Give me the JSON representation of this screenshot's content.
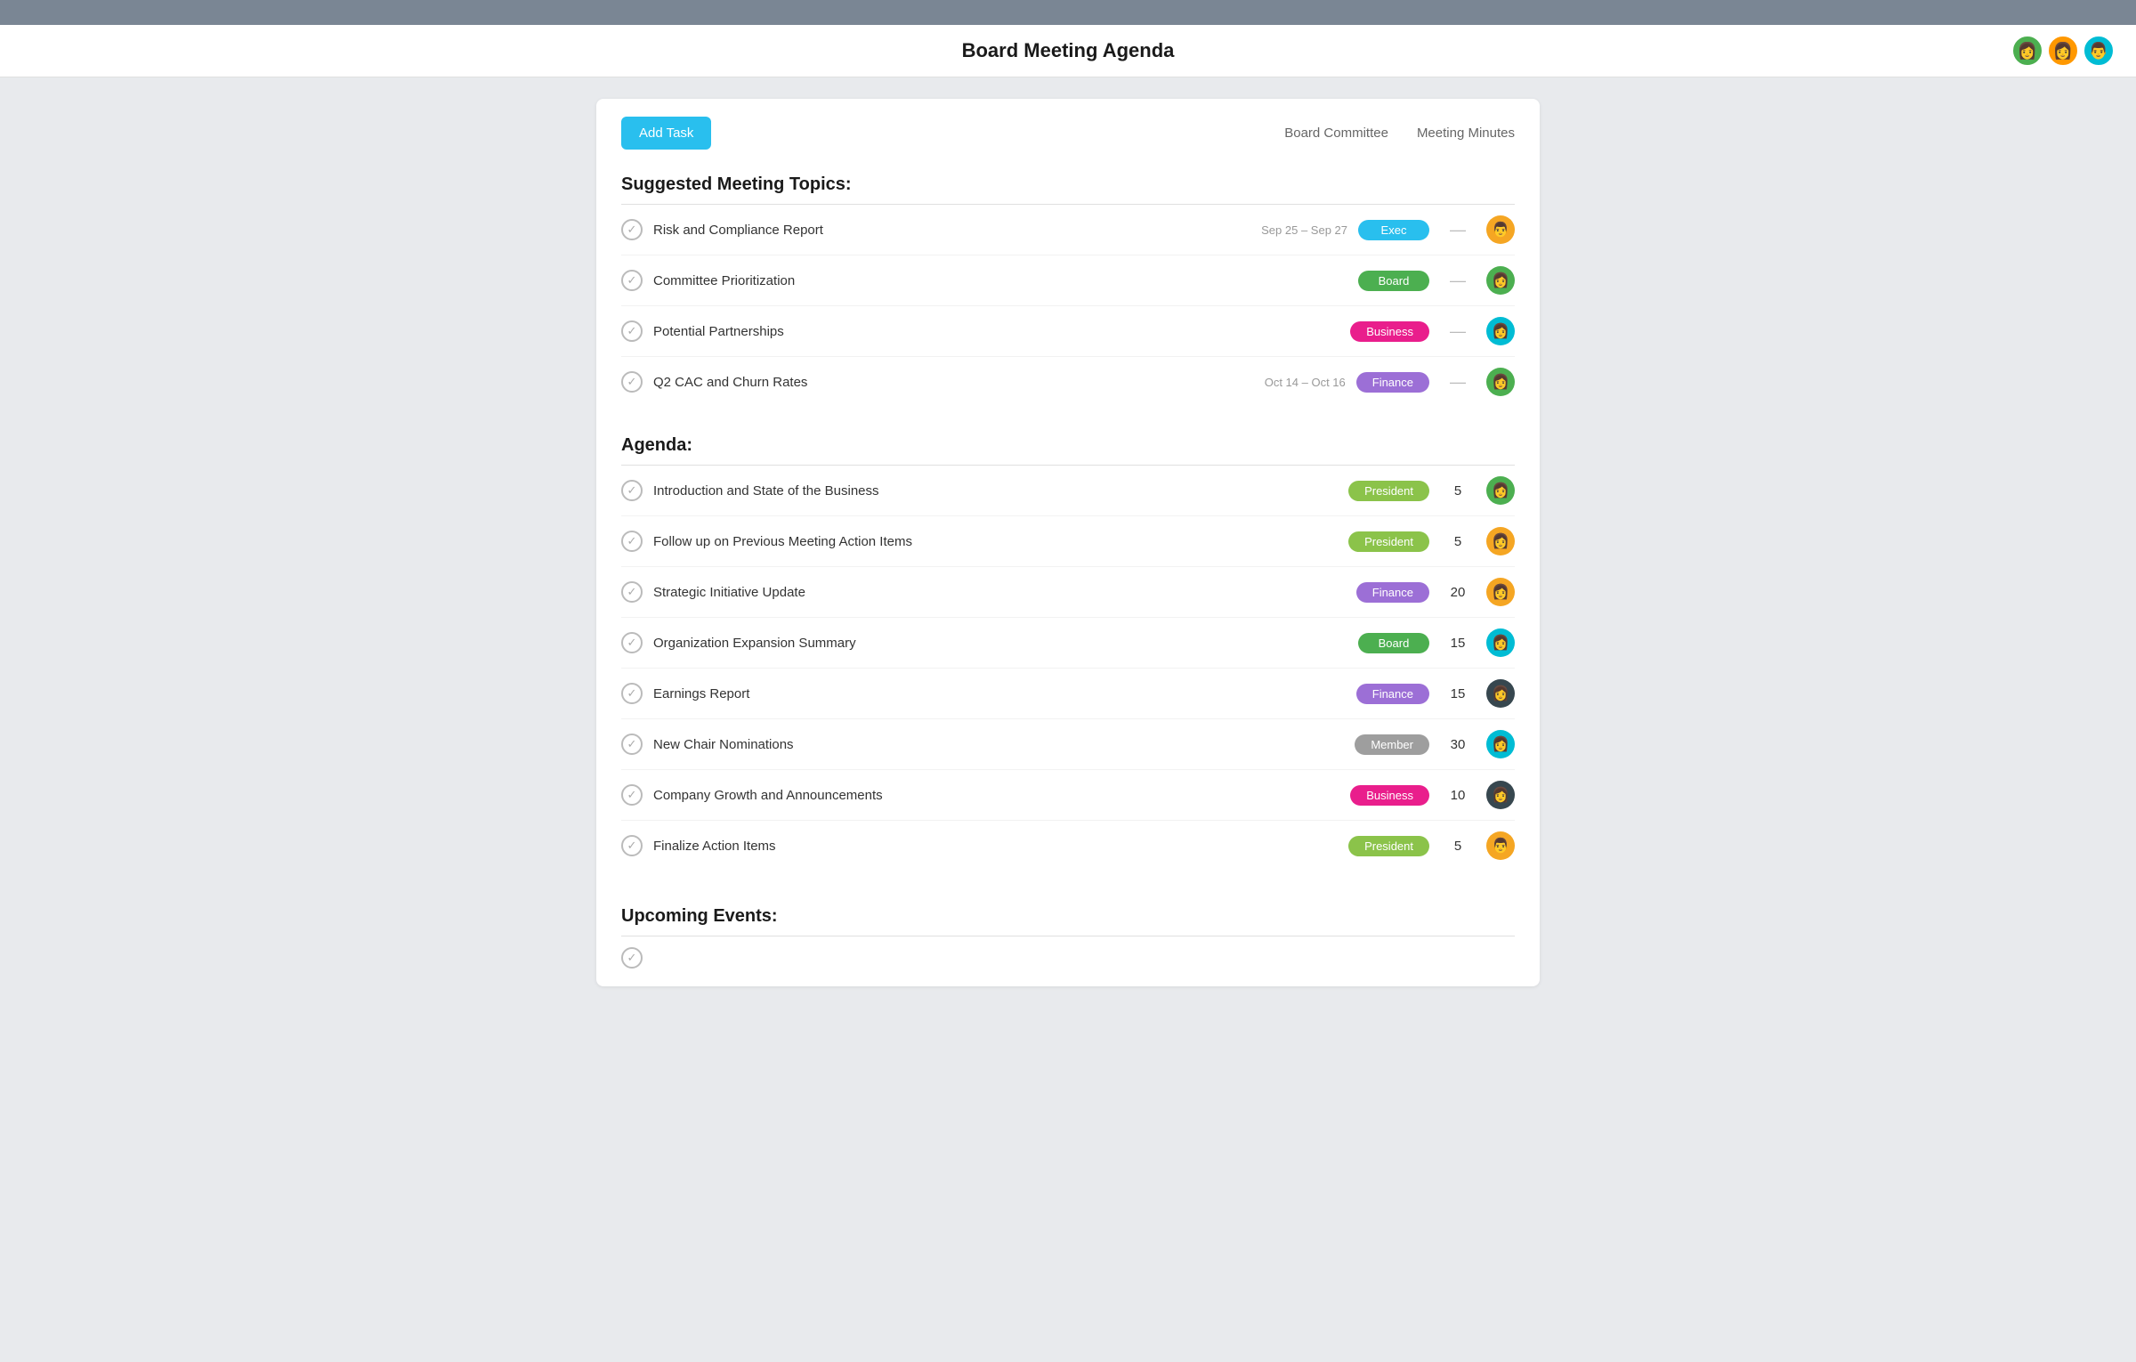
{
  "topBar": {},
  "header": {
    "title": "Board Meeting Agenda",
    "avatars": [
      {
        "id": "av1",
        "emoji": "👩",
        "class": "av-green"
      },
      {
        "id": "av2",
        "emoji": "👩",
        "class": "av-orange"
      },
      {
        "id": "av3",
        "emoji": "👨",
        "class": "av-cyan"
      }
    ]
  },
  "card": {
    "addTaskLabel": "Add Task",
    "nav": [
      {
        "label": "Board Committee",
        "id": "nav-board-committee"
      },
      {
        "label": "Meeting Minutes",
        "id": "nav-meeting-minutes"
      }
    ]
  },
  "suggestedTopics": {
    "title": "Suggested Meeting Topics:",
    "items": [
      {
        "name": "Risk and Compliance Report",
        "date": "Sep 25 – Sep 27",
        "tag": "Exec",
        "tagClass": "tag-exec",
        "hasMinutes": false,
        "avatarEmoji": "👨",
        "avatarClass": "av-yellow"
      },
      {
        "name": "Committee Prioritization",
        "date": "",
        "tag": "Board",
        "tagClass": "tag-board",
        "hasMinutes": false,
        "avatarEmoji": "👩",
        "avatarClass": "av-green"
      },
      {
        "name": "Potential Partnerships",
        "date": "",
        "tag": "Business",
        "tagClass": "tag-business",
        "hasMinutes": false,
        "avatarEmoji": "👩",
        "avatarClass": "av-cyan"
      },
      {
        "name": "Q2 CAC and Churn Rates",
        "date": "Oct 14 – Oct 16",
        "tag": "Finance",
        "tagClass": "tag-finance",
        "hasMinutes": false,
        "avatarEmoji": "👩",
        "avatarClass": "av-green"
      }
    ]
  },
  "agenda": {
    "title": "Agenda:",
    "items": [
      {
        "name": "Introduction and State of the Business",
        "tag": "President",
        "tagClass": "tag-president",
        "minutes": "5",
        "avatarEmoji": "👩",
        "avatarClass": "av-green"
      },
      {
        "name": "Follow up on Previous Meeting Action Items",
        "tag": "President",
        "tagClass": "tag-president",
        "minutes": "5",
        "avatarEmoji": "👩",
        "avatarClass": "av-yellow"
      },
      {
        "name": "Strategic Initiative Update",
        "tag": "Finance",
        "tagClass": "tag-finance",
        "minutes": "20",
        "avatarEmoji": "👩",
        "avatarClass": "av-yellow"
      },
      {
        "name": "Organization Expansion Summary",
        "tag": "Board",
        "tagClass": "tag-board",
        "minutes": "15",
        "avatarEmoji": "👩",
        "avatarClass": "av-cyan"
      },
      {
        "name": "Earnings Report",
        "tag": "Finance",
        "tagClass": "tag-finance",
        "minutes": "15",
        "avatarEmoji": "👩",
        "avatarClass": "av-dark"
      },
      {
        "name": "New Chair Nominations",
        "tag": "Member",
        "tagClass": "tag-member",
        "minutes": "30",
        "avatarEmoji": "👩",
        "avatarClass": "av-cyan"
      },
      {
        "name": "Company Growth and Announcements",
        "tag": "Business",
        "tagClass": "tag-business",
        "minutes": "10",
        "avatarEmoji": "👩",
        "avatarClass": "av-dark"
      },
      {
        "name": "Finalize Action Items",
        "tag": "President",
        "tagClass": "tag-president",
        "minutes": "5",
        "avatarEmoji": "👨",
        "avatarClass": "av-yellow"
      }
    ]
  },
  "upcomingEvents": {
    "title": "Upcoming Events:"
  }
}
